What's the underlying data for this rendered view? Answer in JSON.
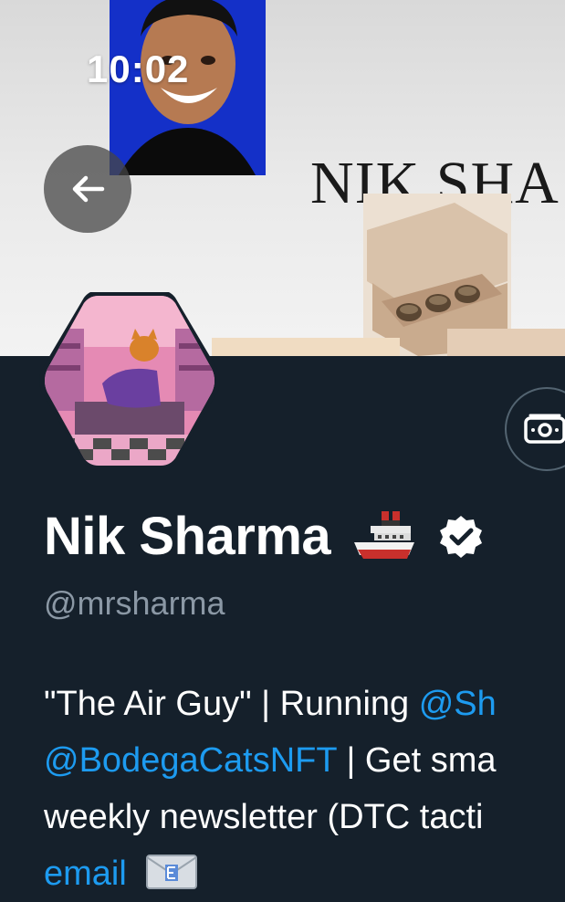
{
  "status_bar": {
    "time": "10:02"
  },
  "banner": {
    "brand_text": "NIK SHA"
  },
  "profile": {
    "name": "Nik Sharma",
    "handle": "@mrsharma"
  },
  "bio": {
    "line1_text": "\"The Air Guy\" | Running ",
    "line1_link": "@Sh",
    "line2_link": "@BodegaCatsNFT",
    "line2_text": " | Get sma",
    "line3_text": "weekly newsletter (DTC tacti",
    "line4_link": "email"
  },
  "icons": {
    "back": "arrow-left-icon",
    "tip": "money-icon",
    "verified": "verified-badge-icon",
    "ship": "ship-emoji-icon",
    "email": "envelope-email-icon"
  },
  "colors": {
    "background": "#15202b",
    "link": "#1d9bf0",
    "secondary_text": "#8b98a5",
    "primary_text": "#ffffff"
  }
}
